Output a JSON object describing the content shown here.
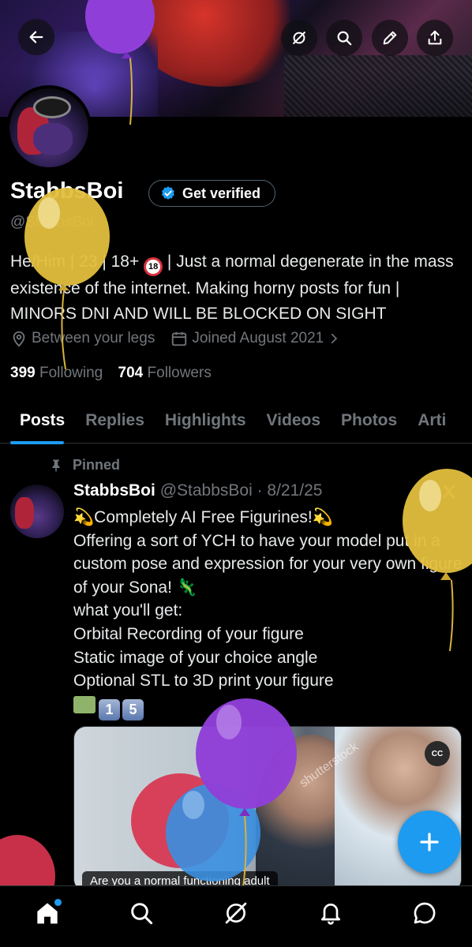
{
  "header": {
    "back_icon": "arrow-left-icon",
    "actions": [
      "grok-icon",
      "search-icon",
      "edit-icon",
      "share-icon"
    ]
  },
  "profile": {
    "display_name": "StabbsBoi",
    "verify_label": "Get verified",
    "handle": "@StabbsBoi",
    "bio_before": "He/Him | 23 | 18+ ",
    "bio_badge": "18",
    "bio_after": " | Just a normal degenerate in the mass existence of the internet. Making horny posts for fun | MINORS DNI AND WILL BE BLOCKED ON SIGHT",
    "location": "Between your legs",
    "joined": "Joined August 2021",
    "following_count": "399",
    "following_label": "Following",
    "followers_count": "704",
    "followers_label": "Followers"
  },
  "tabs": [
    {
      "label": "Posts",
      "active": true
    },
    {
      "label": "Replies"
    },
    {
      "label": "Highlights"
    },
    {
      "label": "Videos"
    },
    {
      "label": "Photos"
    },
    {
      "label": "Arti"
    }
  ],
  "post": {
    "pinned_label": "Pinned",
    "author": "StabbsBoi",
    "handle_date": "@StabbsBoi · 8/21/25",
    "line1": "💫Completely AI Free Figurines!💫",
    "line2": "Offering a sort of YCH to have your model put in a custom pose and expression for your very own figure of your Sona! 🦎",
    "line3": "what you'll get:",
    "line4": "Orbital Recording of your figure",
    "line5": "Static image of your choice angle",
    "line6": "Optional STL to 3D print your figure",
    "price_digits": [
      "1",
      "5"
    ],
    "media_caption": "Are you a normal functioning adult",
    "cc_label": "CC",
    "watermark": "shutterstock"
  },
  "nav": [
    "home-icon",
    "search-icon",
    "grok-icon",
    "bell-icon",
    "messages-icon"
  ],
  "colors": {
    "accent": "#1d9bf0",
    "background": "#000000",
    "secondary_text": "#71767b",
    "balloon_purple": "#8f3fd8",
    "balloon_yellow": "#e2bf3d",
    "balloon_red": "#d9344f",
    "balloon_blue": "#3b8fe0"
  }
}
